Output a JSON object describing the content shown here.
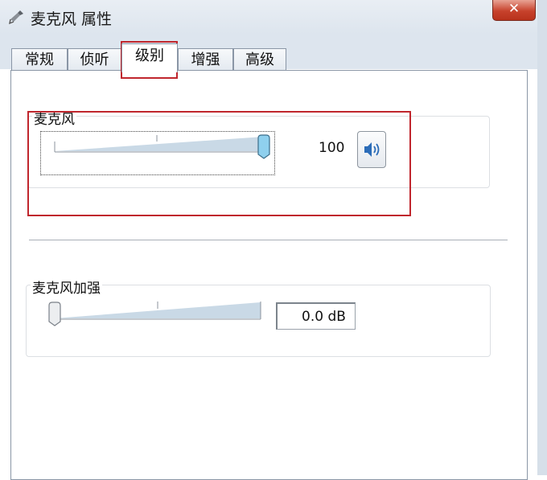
{
  "window": {
    "title": "麦克风 属性",
    "close_icon": "close-icon",
    "title_icon": "microphone-icon"
  },
  "tabs": [
    {
      "label": "常规",
      "active": false
    },
    {
      "label": "侦听",
      "active": false
    },
    {
      "label": "级别",
      "active": true
    },
    {
      "label": "增强",
      "active": false
    },
    {
      "label": "高级",
      "active": false
    }
  ],
  "levels": {
    "microphone": {
      "label": "麦克风",
      "value": "100",
      "level": 1.0,
      "mute_icon": "speaker-icon"
    },
    "boost": {
      "label": "麦克风加强",
      "value": "0.0 dB",
      "level": 0.0
    }
  },
  "colors": {
    "highlight": "#c0262d",
    "slider_fill": "#c9d9e6",
    "thumb_active": "#8fd0ee",
    "close_button": "#c7422c"
  }
}
